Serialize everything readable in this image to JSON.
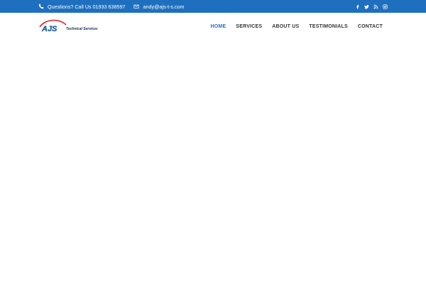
{
  "topbar": {
    "phone_text": "Questions? Call Us 01933 638597",
    "email_text": "andy@ajs-t-s.com",
    "phone_icon": "phone-icon",
    "email_icon": "envelope-icon",
    "social": [
      "facebook-icon",
      "twitter-icon",
      "rss-icon",
      "instagram-icon"
    ]
  },
  "logo": {
    "wordmark": "AJS",
    "tagline": "Technical Services"
  },
  "nav": {
    "items": [
      "HOME",
      "SERVICES",
      "ABOUT US",
      "TESTIMONIALS",
      "CONTACT"
    ],
    "active": "HOME"
  },
  "colors": {
    "topbar_bg": "#1f6fbf",
    "accent": "#1f6fbf",
    "nav_text": "#333333",
    "logo_red": "#d62027",
    "logo_navy": "#0d2c55"
  }
}
